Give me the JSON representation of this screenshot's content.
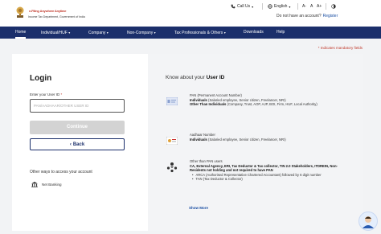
{
  "header": {
    "brand_title": "e-Filing",
    "brand_tag": "Anywhere Anytime",
    "brand_sub": "Income Tax Department, Government of India",
    "call_us": "Call Us",
    "language": "English",
    "font_minus": "A-",
    "font_normal": "A",
    "font_plus": "A+",
    "no_account": "Do not have an account?",
    "register": "Register"
  },
  "nav": {
    "items": [
      {
        "label": "Home"
      },
      {
        "label": "Individual/HUF"
      },
      {
        "label": "Company"
      },
      {
        "label": "Non-Company"
      },
      {
        "label": "Tax Professionals & Others"
      },
      {
        "label": "Downloads"
      },
      {
        "label": "Help"
      }
    ]
  },
  "mandatory_note": "Indicates mandatory fields",
  "login": {
    "title": "Login",
    "uid_label": "Enter your User ID",
    "uid_placeholder": "PAN/AADHAAR/OTHER USER ID",
    "continue_label": "Continue",
    "back_label": "Back",
    "other_ways": "Other ways to access your account",
    "net_banking": "Net Banking"
  },
  "know": {
    "title_prefix": "Know about your",
    "title_bold": "User ID",
    "pan": {
      "heading": "PAN (Permanent Account Number)",
      "l1_bold": "Individuals",
      "l1": "(Salaried employee, Senior citizen, Freelancer, NRI)",
      "l2_bold": "Other Than Individuals",
      "l2": "(Company, Trust, AOP, AJP, BOI, Firm, HUF, Local Authority)"
    },
    "aadhaar": {
      "heading": "Aadhaar Number",
      "l1_bold": "Individuals",
      "l1": "(Salaried employee, Senior citizen, Freelancer, NRI)"
    },
    "other": {
      "heading": "Other than PAN users",
      "bold": "CA, External Agency, ERI, Tax Deductor & Tax collector, TIN 2.0 Stakeholders, ITDREIN, Non-Residents not holding and not required to have PAN",
      "bullet1": "ARCA (Authorised Representative Chartered Accountant) followed by 6 digit number",
      "bullet2": "TAN (Tax Deductor & Collector)"
    },
    "show_more": "Show More"
  },
  "colors": {
    "nav_bg": "#1b2f6b",
    "accent": "#1b4fa3",
    "required": "#c0392b"
  }
}
